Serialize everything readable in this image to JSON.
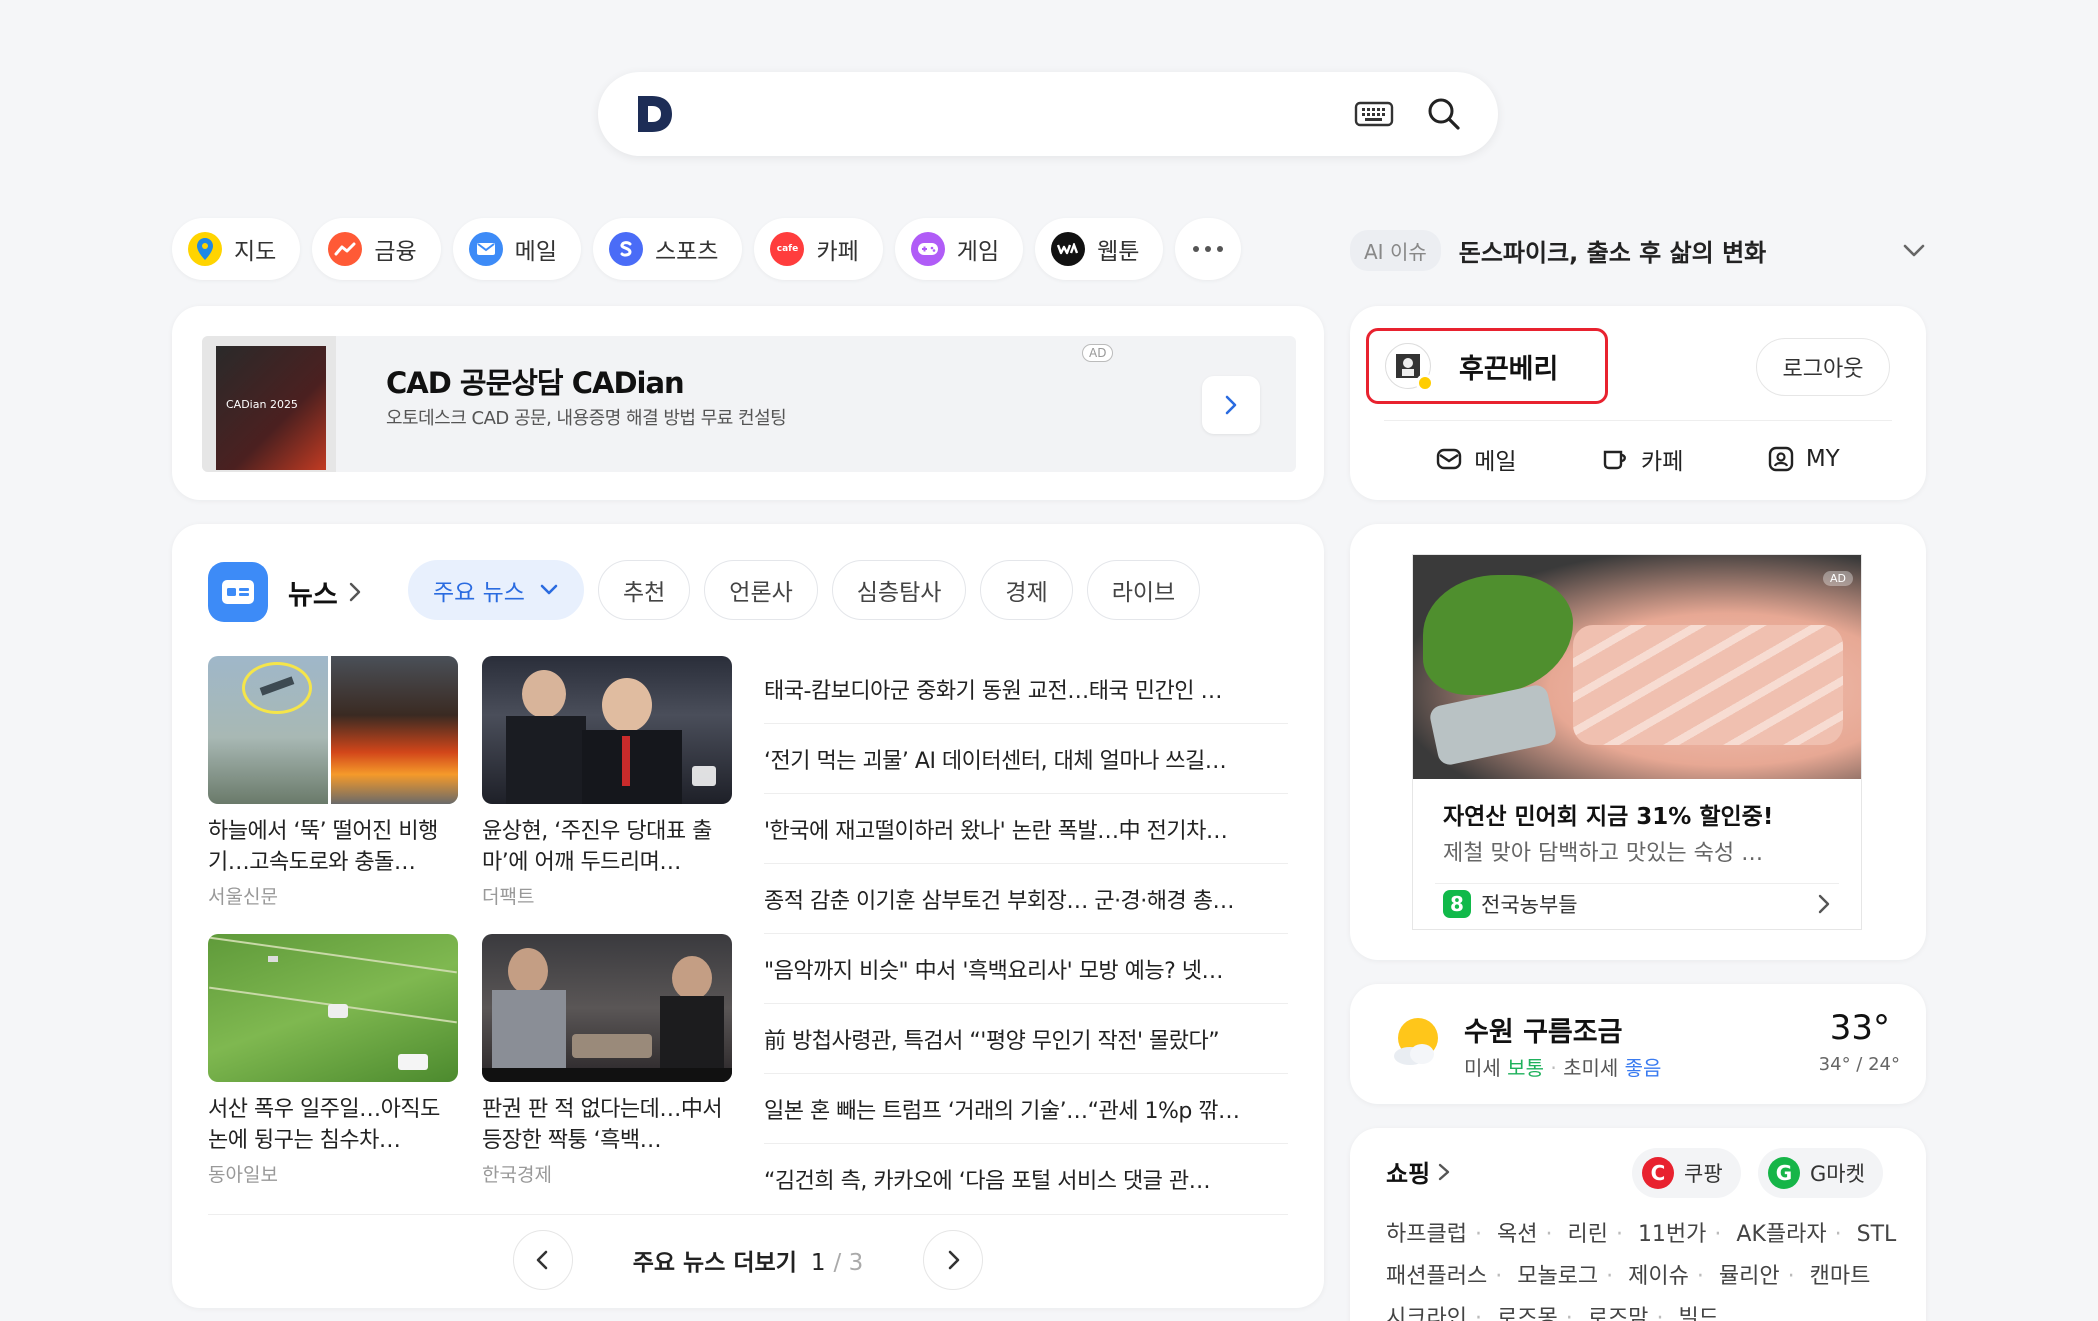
{
  "search": {
    "logo_alt": "D"
  },
  "categories": [
    {
      "label": "지도",
      "icon": "map-pin-icon",
      "color": "#ffd400"
    },
    {
      "label": "금융",
      "icon": "finance-icon",
      "color": "#ff5a36"
    },
    {
      "label": "메일",
      "icon": "mail-icon",
      "color": "#3d8bf7"
    },
    {
      "label": "스포츠",
      "icon": "sports-icon",
      "color": "#4a6cf7"
    },
    {
      "label": "카페",
      "icon": "cafe-icon",
      "color": "#ff3d3d"
    },
    {
      "label": "게임",
      "icon": "game-icon",
      "color": "#b05cf7"
    },
    {
      "label": "웹툰",
      "icon": "webtoon-icon",
      "color": "#111111"
    }
  ],
  "ai_issue": {
    "badge": "AI 이슈",
    "text": "돈스파이크, 출소 후 삶의 변화"
  },
  "ad_banner": {
    "product_label": "CADian 2025",
    "title": "CAD 공문상담 CADian",
    "desc": "오토데스크 CAD 공문, 내용증명 해결 방법 무료 컨설팅",
    "tag": "AD"
  },
  "login": {
    "username": "후끈베리",
    "logout": "로그아웃",
    "links": [
      {
        "label": "메일",
        "icon": "mail-outline-icon"
      },
      {
        "label": "카페",
        "icon": "cafe-outline-icon"
      },
      {
        "label": "MY",
        "icon": "my-outline-icon"
      }
    ]
  },
  "news": {
    "title": "뉴스",
    "tabs": [
      "주요 뉴스",
      "추천",
      "언론사",
      "심층탐사",
      "경제",
      "라이브"
    ],
    "thumbs": [
      {
        "title": "하늘에서 ‘뚝’ 떨어진 비행기…고속도로와 충돌…",
        "source": "서울신문"
      },
      {
        "title": "윤상현, ‘주진우 당대표 출마’에 어깨 두드리며…",
        "source": "더팩트"
      },
      {
        "title": "서산 폭우 일주일…아직도 논에 뒹구는 침수차…",
        "source": "동아일보"
      },
      {
        "title": "판권 판 적 없다는데…中서 등장한 짝퉁 ‘흑백…",
        "source": "한국경제"
      }
    ],
    "headlines": [
      "태국-캄보디아군 중화기 동원 교전…태국 민간인 …",
      "‘전기 먹는 괴물’ AI 데이터센터, 대체 얼마나 쓰길…",
      "'한국에 재고떨이하러 왔나' 논란 폭발…中 전기차…",
      "종적 감춘 이기훈 삼부토건 부회장… 군·경·해경 총…",
      "\"음악까지 비슷\" 中서 '흑백요리사' 모방 예능? 넷…",
      "前 방첩사령관, 특검서 “'평양 무인기 작전' 몰랐다”",
      "일본 혼 빼는 트럼프 ‘거래의 기술’…“관세 1%p 깎…",
      "“김건희 측, 카카오에 ‘다음 포털 서비스 댓글 관…"
    ],
    "pager": {
      "label": "주요 뉴스 더보기",
      "current": "1",
      "total": "3"
    }
  },
  "promo": {
    "tag": "AD",
    "title": "자연산 민어회 지금 31% 할인중!",
    "desc": "제철 맞아 담백하고 맛있는 숙성 …",
    "brand": "전국농부들",
    "brand_icon": "8"
  },
  "weather": {
    "title": "수원 구름조금",
    "pm10_label": "미세",
    "pm10_value": "보통",
    "pm25_label": "초미세",
    "pm25_value": "좋음",
    "temp": "33°",
    "range": "34° / 24°"
  },
  "shopping": {
    "title": "쇼핑",
    "pills": [
      {
        "label": "쿠팡",
        "icon": "C",
        "color": "#e8222f"
      },
      {
        "label": "G마켓",
        "icon": "G",
        "color": "#16b548"
      }
    ],
    "links": [
      "하프클럽",
      "옥션",
      "리린",
      "11번가",
      "AK플라자",
      "STL",
      "패션플러스",
      "모놀로그",
      "제이슈",
      "뮬리안",
      "캔마트",
      "시크라인",
      "로즈몽",
      "로즈맘",
      "빌드"
    ]
  }
}
